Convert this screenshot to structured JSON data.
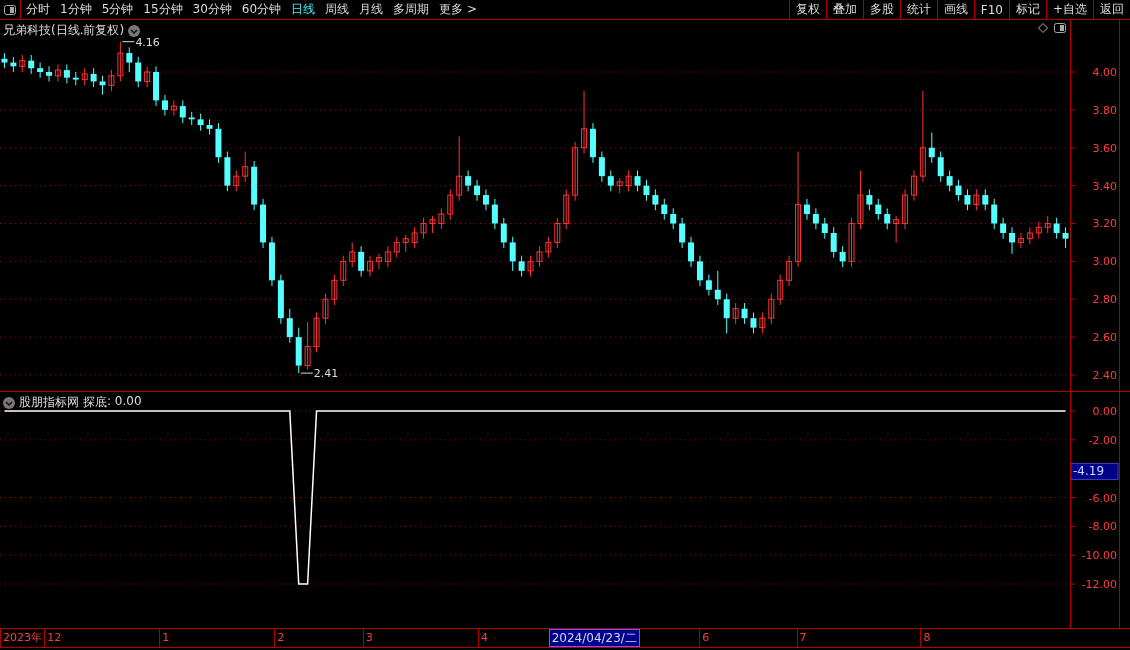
{
  "toolbar": {
    "periods": [
      {
        "label": "分时",
        "selected": false
      },
      {
        "label": "1分钟",
        "selected": false
      },
      {
        "label": "5分钟",
        "selected": false
      },
      {
        "label": "15分钟",
        "selected": false
      },
      {
        "label": "30分钟",
        "selected": false
      },
      {
        "label": "60分钟",
        "selected": false
      },
      {
        "label": "日线",
        "selected": true
      },
      {
        "label": "周线",
        "selected": false
      },
      {
        "label": "月线",
        "selected": false
      },
      {
        "label": "多周期",
        "selected": false
      },
      {
        "label": "更多 >",
        "selected": false
      }
    ],
    "buttons": [
      "复权",
      "叠加",
      "多股",
      "统计",
      "画线",
      "F10",
      "标记",
      "+自选",
      "返回"
    ]
  },
  "price_pane": {
    "title": "兄弟科技(日线.前复权)",
    "chart_data": {
      "type": "candlestick",
      "grid": true,
      "ylim": [
        2.3155,
        4.2746
      ],
      "yticks": [
        {
          "value": 4.0,
          "label": "4.00"
        },
        {
          "value": 3.8,
          "label": "3.80"
        },
        {
          "value": 3.6,
          "label": "3.60"
        },
        {
          "value": 3.4,
          "label": "3.40"
        },
        {
          "value": 3.2,
          "label": "3.20"
        },
        {
          "value": 3.0,
          "label": "3.00"
        },
        {
          "value": 2.8,
          "label": "2.80"
        },
        {
          "value": 2.6,
          "label": "2.60"
        },
        {
          "value": 2.4,
          "label": "2.40"
        }
      ],
      "annotations": [
        "4.16",
        "2.41"
      ],
      "ohlc": [
        [
          4.07,
          4.1,
          4.02,
          4.05
        ],
        [
          4.05,
          4.08,
          4.0,
          4.03
        ],
        [
          4.03,
          4.09,
          4.0,
          4.06
        ],
        [
          4.06,
          4.09,
          3.99,
          4.02
        ],
        [
          4.02,
          4.05,
          3.97,
          4.0
        ],
        [
          4.0,
          4.03,
          3.95,
          3.98
        ],
        [
          3.98,
          4.04,
          3.95,
          4.01
        ],
        [
          4.01,
          4.04,
          3.94,
          3.97
        ],
        [
          3.97,
          4.0,
          3.93,
          3.96
        ],
        [
          3.96,
          4.02,
          3.93,
          3.99
        ],
        [
          3.99,
          4.02,
          3.92,
          3.95
        ],
        [
          3.95,
          3.98,
          3.88,
          3.93
        ],
        [
          3.93,
          4.01,
          3.9,
          3.98
        ],
        [
          3.98,
          4.16,
          3.95,
          4.1
        ],
        [
          4.1,
          4.13,
          4.0,
          4.05
        ],
        [
          4.05,
          4.08,
          3.92,
          3.95
        ],
        [
          3.95,
          4.03,
          3.92,
          4.0
        ],
        [
          4.0,
          4.03,
          3.82,
          3.85
        ],
        [
          3.85,
          3.88,
          3.77,
          3.8
        ],
        [
          3.8,
          3.85,
          3.77,
          3.82
        ],
        [
          3.82,
          3.85,
          3.73,
          3.76
        ],
        [
          3.76,
          3.79,
          3.72,
          3.75
        ],
        [
          3.75,
          3.78,
          3.69,
          3.72
        ],
        [
          3.72,
          3.75,
          3.67,
          3.7
        ],
        [
          3.7,
          3.73,
          3.52,
          3.55
        ],
        [
          3.55,
          3.58,
          3.37,
          3.4
        ],
        [
          3.4,
          3.48,
          3.37,
          3.45
        ],
        [
          3.45,
          3.58,
          3.42,
          3.5
        ],
        [
          3.5,
          3.53,
          3.27,
          3.3
        ],
        [
          3.3,
          3.33,
          3.07,
          3.1
        ],
        [
          3.1,
          3.13,
          2.87,
          2.9
        ],
        [
          2.9,
          2.93,
          2.67,
          2.7
        ],
        [
          2.7,
          2.75,
          2.57,
          2.6
        ],
        [
          2.6,
          2.65,
          2.41,
          2.45
        ],
        [
          2.45,
          2.68,
          2.43,
          2.55
        ],
        [
          2.55,
          2.73,
          2.52,
          2.7
        ],
        [
          2.7,
          2.83,
          2.67,
          2.8
        ],
        [
          2.8,
          2.93,
          2.77,
          2.9
        ],
        [
          2.9,
          3.03,
          2.87,
          3.0
        ],
        [
          3.0,
          3.1,
          2.97,
          3.05
        ],
        [
          3.05,
          3.08,
          2.92,
          2.95
        ],
        [
          2.95,
          3.03,
          2.92,
          3.0
        ],
        [
          3.0,
          3.04,
          2.96,
          3.02
        ],
        [
          3.0,
          3.08,
          2.97,
          3.05
        ],
        [
          3.05,
          3.13,
          3.02,
          3.1
        ],
        [
          3.1,
          3.14,
          3.05,
          3.12
        ],
        [
          3.1,
          3.18,
          3.07,
          3.15
        ],
        [
          3.15,
          3.23,
          3.12,
          3.2
        ],
        [
          3.2,
          3.24,
          3.15,
          3.22
        ],
        [
          3.2,
          3.28,
          3.17,
          3.25
        ],
        [
          3.25,
          3.38,
          3.22,
          3.35
        ],
        [
          3.35,
          3.66,
          3.32,
          3.45
        ],
        [
          3.45,
          3.48,
          3.37,
          3.4
        ],
        [
          3.4,
          3.43,
          3.32,
          3.35
        ],
        [
          3.35,
          3.38,
          3.27,
          3.3
        ],
        [
          3.3,
          3.33,
          3.17,
          3.2
        ],
        [
          3.2,
          3.23,
          3.07,
          3.1
        ],
        [
          3.1,
          3.13,
          2.95,
          3.0
        ],
        [
          3.0,
          3.03,
          2.92,
          2.95
        ],
        [
          2.95,
          3.03,
          2.92,
          3.0
        ],
        [
          3.0,
          3.08,
          2.97,
          3.05
        ],
        [
          3.05,
          3.13,
          3.02,
          3.1
        ],
        [
          3.1,
          3.23,
          3.07,
          3.2
        ],
        [
          3.2,
          3.38,
          3.17,
          3.35
        ],
        [
          3.35,
          3.63,
          3.32,
          3.6
        ],
        [
          3.6,
          3.9,
          3.57,
          3.7
        ],
        [
          3.7,
          3.73,
          3.52,
          3.55
        ],
        [
          3.55,
          3.58,
          3.42,
          3.45
        ],
        [
          3.45,
          3.48,
          3.37,
          3.4
        ],
        [
          3.4,
          3.44,
          3.36,
          3.42
        ],
        [
          3.4,
          3.48,
          3.37,
          3.45
        ],
        [
          3.45,
          3.48,
          3.37,
          3.4
        ],
        [
          3.4,
          3.43,
          3.32,
          3.35
        ],
        [
          3.35,
          3.38,
          3.27,
          3.3
        ],
        [
          3.3,
          3.33,
          3.22,
          3.25
        ],
        [
          3.25,
          3.28,
          3.17,
          3.2
        ],
        [
          3.2,
          3.23,
          3.07,
          3.1
        ],
        [
          3.1,
          3.13,
          2.97,
          3.0
        ],
        [
          3.0,
          3.03,
          2.87,
          2.9
        ],
        [
          2.9,
          2.93,
          2.82,
          2.85
        ],
        [
          2.85,
          2.95,
          2.77,
          2.8
        ],
        [
          2.8,
          2.83,
          2.62,
          2.7
        ],
        [
          2.7,
          2.78,
          2.67,
          2.75
        ],
        [
          2.75,
          2.78,
          2.67,
          2.7
        ],
        [
          2.7,
          2.73,
          2.62,
          2.65
        ],
        [
          2.65,
          2.73,
          2.62,
          2.7
        ],
        [
          2.7,
          2.83,
          2.67,
          2.8
        ],
        [
          2.8,
          2.93,
          2.77,
          2.9
        ],
        [
          2.9,
          3.03,
          2.87,
          3.0
        ],
        [
          3.0,
          3.58,
          2.97,
          3.3
        ],
        [
          3.3,
          3.33,
          3.22,
          3.25
        ],
        [
          3.25,
          3.28,
          3.17,
          3.2
        ],
        [
          3.2,
          3.23,
          3.12,
          3.15
        ],
        [
          3.15,
          3.18,
          3.02,
          3.05
        ],
        [
          3.05,
          3.08,
          2.97,
          3.0
        ],
        [
          3.0,
          3.23,
          2.97,
          3.2
        ],
        [
          3.2,
          3.48,
          3.17,
          3.35
        ],
        [
          3.35,
          3.38,
          3.27,
          3.3
        ],
        [
          3.3,
          3.33,
          3.22,
          3.25
        ],
        [
          3.25,
          3.28,
          3.17,
          3.2
        ],
        [
          3.2,
          3.24,
          3.1,
          3.22
        ],
        [
          3.2,
          3.38,
          3.17,
          3.35
        ],
        [
          3.35,
          3.48,
          3.32,
          3.45
        ],
        [
          3.45,
          3.9,
          3.42,
          3.6
        ],
        [
          3.6,
          3.68,
          3.52,
          3.55
        ],
        [
          3.55,
          3.58,
          3.42,
          3.45
        ],
        [
          3.45,
          3.48,
          3.37,
          3.4
        ],
        [
          3.4,
          3.43,
          3.32,
          3.35
        ],
        [
          3.35,
          3.38,
          3.27,
          3.3
        ],
        [
          3.3,
          3.38,
          3.27,
          3.35
        ],
        [
          3.35,
          3.38,
          3.27,
          3.3
        ],
        [
          3.3,
          3.33,
          3.17,
          3.2
        ],
        [
          3.2,
          3.23,
          3.12,
          3.15
        ],
        [
          3.15,
          3.18,
          3.04,
          3.1
        ],
        [
          3.1,
          3.15,
          3.07,
          3.12
        ],
        [
          3.12,
          3.18,
          3.09,
          3.15
        ],
        [
          3.15,
          3.21,
          3.12,
          3.18
        ],
        [
          3.18,
          3.24,
          3.15,
          3.2
        ],
        [
          3.2,
          3.23,
          3.12,
          3.15
        ],
        [
          3.15,
          3.18,
          3.07,
          3.12
        ]
      ]
    }
  },
  "indicator_pane": {
    "source": "股朋指标网",
    "reading": ": 0.00",
    "current_value": "-4.19",
    "chart_data": {
      "type": "line",
      "grid": true,
      "ylim": [
        -15.052,
        1.318
      ],
      "yticks": [
        {
          "value": 0,
          "label": "0.00"
        },
        {
          "value": -2,
          "label": "-2.00"
        },
        {
          "value": -6,
          "label": "-6.00"
        },
        {
          "value": -8,
          "label": "-8.00"
        },
        {
          "value": -10,
          "label": "-10.00"
        },
        {
          "value": -12,
          "label": "-12.00"
        }
      ],
      "series": [
        {
          "name": "探底",
          "color": "#ffffff",
          "values": [
            0,
            0,
            0,
            0,
            0,
            0,
            0,
            0,
            0,
            0,
            0,
            0,
            0,
            0,
            0,
            0,
            0,
            0,
            0,
            0,
            0,
            0,
            0,
            0,
            0,
            0,
            0,
            0,
            0,
            0,
            0,
            0,
            0,
            -12,
            -12,
            0,
            0,
            0,
            0,
            0,
            0,
            0,
            0,
            0,
            0,
            0,
            0,
            0,
            0,
            0,
            0,
            0,
            0,
            0,
            0,
            0,
            0,
            0,
            0,
            0,
            0,
            0,
            0,
            0,
            0,
            0,
            0,
            0,
            0,
            0,
            0,
            0,
            0,
            0,
            0,
            0,
            0,
            0,
            0,
            0,
            0,
            0,
            0,
            0,
            0,
            0,
            0,
            0,
            0,
            0,
            0,
            0,
            0,
            0,
            0,
            0,
            0,
            0,
            0,
            0,
            0,
            0,
            0,
            0,
            0,
            0,
            0,
            0,
            0,
            0,
            0,
            0,
            0,
            0,
            0,
            0,
            0,
            0,
            0,
            0
          ]
        }
      ]
    }
  },
  "date_axis": {
    "labels": [
      "2023年",
      "12",
      "1",
      "2",
      "3",
      "4",
      "6",
      "7",
      "8"
    ],
    "cursor_date": "2024/04/23/二"
  }
}
